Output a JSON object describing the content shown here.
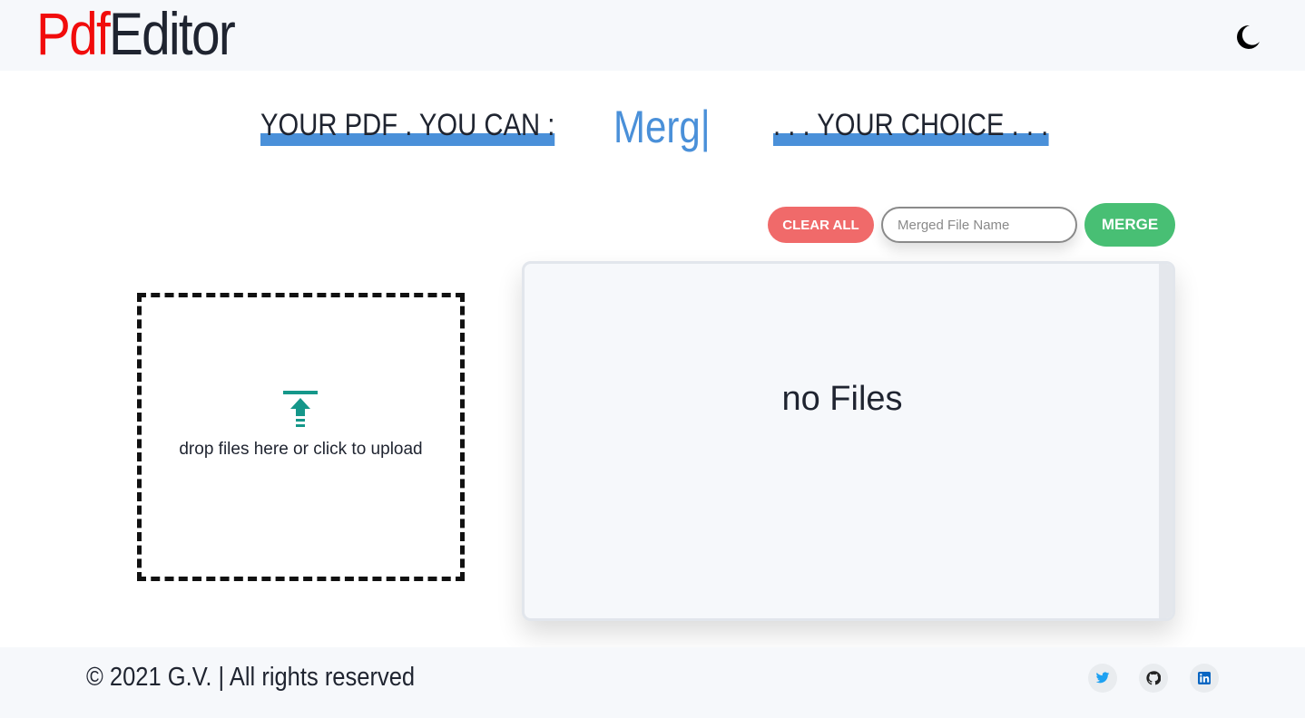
{
  "header": {
    "logo_part1": "Pdf",
    "logo_part2": "Editor",
    "theme_toggle_icon": "moon-icon"
  },
  "tagline": {
    "left": "YOUR PDF . YOU CAN :",
    "typed": "Merg|",
    "right": ". . . YOUR CHOICE . . ."
  },
  "toolbar": {
    "clear_label": "CLEAR ALL",
    "filename_placeholder": "Merged File Name",
    "filename_value": "",
    "merge_label": "MERGE"
  },
  "dropzone": {
    "icon": "upload-icon",
    "text": "drop files here or click to upload"
  },
  "files": {
    "empty_text": "no Files",
    "items": []
  },
  "footer": {
    "copyright": "© 2021 G.V. | All rights reserved",
    "social": [
      {
        "icon": "twitter-icon"
      },
      {
        "icon": "github-icon"
      },
      {
        "icon": "linkedin-icon"
      }
    ]
  },
  "colors": {
    "logo_red": "#f10c0c",
    "accent_blue": "#4a90d9",
    "clear_red": "#f06a6a",
    "merge_green": "#48bf74",
    "upload_teal": "#15978a",
    "twitter_blue": "#1da1f2",
    "linkedin_blue": "#0a66c2"
  }
}
